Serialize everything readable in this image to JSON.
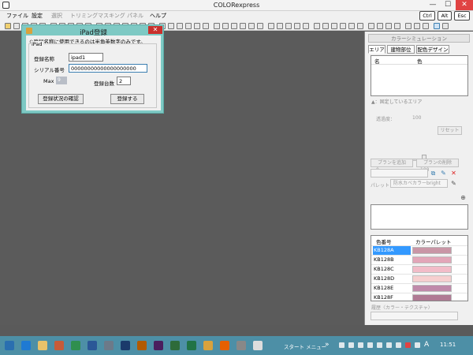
{
  "window": {
    "title": "COLORexpress",
    "minimize": "—",
    "maximize": "☐",
    "close": "✕"
  },
  "menu": {
    "items": [
      {
        "label": "ファイル",
        "enabled": true
      },
      {
        "label": "設定",
        "enabled": true
      },
      {
        "label": "選択",
        "enabled": false
      },
      {
        "label": "トリミング",
        "enabled": false
      },
      {
        "label": "マスキング",
        "enabled": false
      },
      {
        "label": "パネル",
        "enabled": false
      },
      {
        "label": "ヘルプ",
        "enabled": true
      }
    ],
    "keys": [
      "Ctrl",
      "Alt",
      "Esc"
    ]
  },
  "dialog": {
    "title": "iPad登録",
    "note": "※登録名称に使用できるのは半角英数字のみです。",
    "group_label": "iPad",
    "name_label": "登録名称",
    "name_value": "ipad1",
    "serial_label": "シリアル番号",
    "serial_value": "00000000000000000000",
    "max_label": "Max",
    "max_value": "9",
    "count_label": "登録台数",
    "count_value": "2",
    "check_button": "登録状況の確認",
    "register_button": "登録する",
    "close": "✕"
  },
  "panel": {
    "title": "カラーシミュレーション",
    "tabs": [
      "エリア",
      "建物部位",
      "配色デザイン"
    ],
    "area_columns": [
      "名",
      "色"
    ],
    "area_note": "▲：固定しているエリア",
    "opacity_label": "透過度：",
    "opacity_value": "100",
    "slider_min": "0",
    "slider_max": "100",
    "opacity_level": 1.0,
    "reset_button": "リセット",
    "add_plan_button": "プランを追加",
    "delete_plan_button": "プランの削除",
    "palette_label": "パレット",
    "palette_value": "防水カベカラーbright",
    "color_table_headers": [
      "色番号",
      "カラーパレット"
    ],
    "colors": [
      {
        "code": "KB128A",
        "hex": "#c996a6",
        "selected": true
      },
      {
        "code": "KB128B",
        "hex": "#e2a6b8",
        "selected": false
      },
      {
        "code": "KB128C",
        "hex": "#f2bcc8",
        "selected": false
      },
      {
        "code": "KB128D",
        "hex": "#f6cfcf",
        "selected": false
      },
      {
        "code": "KB128E",
        "hex": "#c08aaa",
        "selected": false
      },
      {
        "code": "KB128F",
        "hex": "#b07a94",
        "selected": false
      }
    ],
    "history_label": "履歴〈カラー・テクスチャ〉"
  },
  "taskbar": {
    "start_menu_label": "スタート メニュー",
    "chevron": "»",
    "ime": "A",
    "clock": "11:51",
    "apps": [
      "start-icon",
      "ie-icon",
      "folder-icon",
      "powerpoint-icon",
      "excel-icon",
      "word-icon",
      "app-icon",
      "photoshop-icon",
      "illustrator-icon",
      "indesign-icon",
      "dreamweaver-icon",
      "excel2-icon",
      "chrome-icon",
      "firefox-icon",
      "app2-icon",
      "colorexpress-icon"
    ]
  },
  "colors": {
    "canvas": "#5b5b5b",
    "dialog_frame": "#7ec9c4",
    "taskbar": "#4d8fa6",
    "selection": "#3399ff"
  }
}
